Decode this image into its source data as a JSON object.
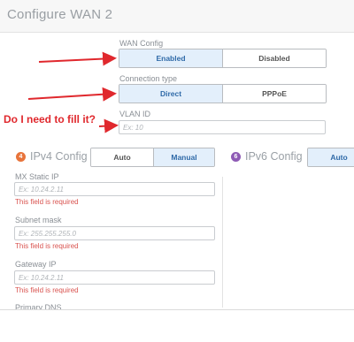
{
  "title": "Configure WAN 2",
  "wan_config": {
    "label": "WAN Config",
    "options": [
      "Enabled",
      "Disabled"
    ],
    "selected": "Enabled"
  },
  "connection_type": {
    "label": "Connection type",
    "options": [
      "Direct",
      "PPPoE"
    ],
    "selected": "Direct"
  },
  "vlan": {
    "label": "VLAN ID",
    "placeholder": "Ex: 10"
  },
  "ipv4": {
    "badge": "4",
    "title": "IPv4 Config",
    "options": [
      "Auto",
      "Manual"
    ],
    "selected": "Manual",
    "fields": [
      {
        "label": "MX Static IP",
        "placeholder": "Ex: 10.24.2.11",
        "error": "This field is required"
      },
      {
        "label": "Subnet mask",
        "placeholder": "Ex: 255.255.255.0",
        "error": "This field is required"
      },
      {
        "label": "Gateway IP",
        "placeholder": "Ex: 10.24.2.11",
        "error": "This field is required"
      },
      {
        "label": "Primary DNS"
      }
    ]
  },
  "ipv6": {
    "badge": "6",
    "title": "IPv6 Config",
    "options": [
      "Auto"
    ],
    "selected": "Auto"
  },
  "annotation": {
    "note": "Do I need to fill it?"
  },
  "colors": {
    "arrow": "#e0282d",
    "ipv4_badge": "#e8743b",
    "ipv6_badge": "#8e5bb5",
    "selected_bg": "#e3effb",
    "selected_text": "#2f6aa8",
    "error": "#d9534f"
  }
}
